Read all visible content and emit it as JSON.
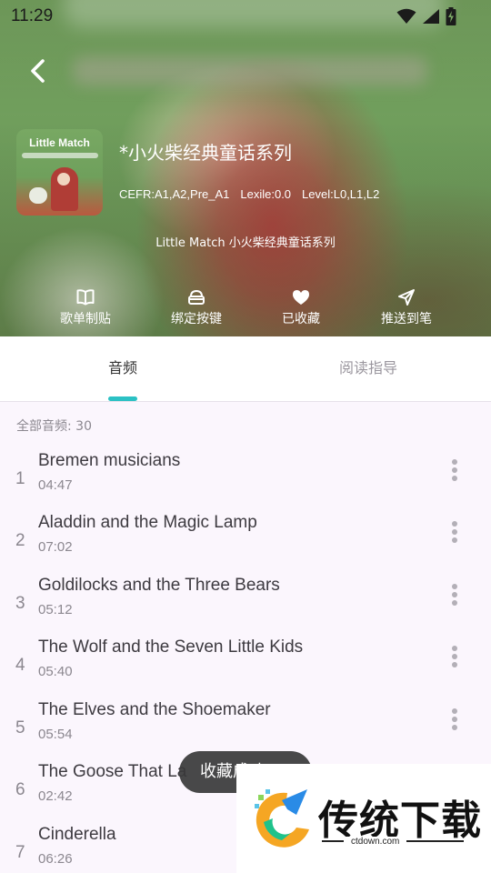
{
  "status_bar": {
    "time": "11:29",
    "icons": [
      "wifi-icon",
      "signal-icon",
      "battery-charging-icon"
    ]
  },
  "album": {
    "cover_title": "Little Match",
    "title": "*小火柴经典童话系列",
    "cefr": "CEFR:A1,A2,Pre_A1",
    "lexile": "Lexile:0.0",
    "level": "Level:L0,L1,L2",
    "description": "Little Match 小火柴经典童话系列"
  },
  "actions": [
    {
      "label": "歌单制贴",
      "icon": "book-icon"
    },
    {
      "label": "绑定按键",
      "icon": "button-icon"
    },
    {
      "label": "已收藏",
      "icon": "heart-icon"
    },
    {
      "label": "推送到笔",
      "icon": "send-icon"
    }
  ],
  "tabs": [
    {
      "label": "音频",
      "active": true
    },
    {
      "label": "阅读指导",
      "active": false
    }
  ],
  "list": {
    "count_label": "全部音频: 30",
    "tracks": [
      {
        "index": "1",
        "title": "Bremen musicians",
        "duration": "04:47"
      },
      {
        "index": "2",
        "title": "Aladdin and the Magic Lamp",
        "duration": "07:02"
      },
      {
        "index": "3",
        "title": "Goldilocks and the Three Bears",
        "duration": "05:12"
      },
      {
        "index": "4",
        "title": "The Wolf and the Seven Little Kids",
        "duration": "05:40"
      },
      {
        "index": "5",
        "title": "The Elves and the Shoemaker",
        "duration": "05:54"
      },
      {
        "index": "6",
        "title": "The Goose That La",
        "duration": "02:42"
      },
      {
        "index": "7",
        "title": "Cinderella",
        "duration": "06:26"
      }
    ]
  },
  "toast": {
    "text": "收藏成功"
  },
  "watermark": {
    "name": "传统下载",
    "url": "ctdown.com"
  },
  "colors": {
    "accent": "#2bc1c4",
    "list_bg": "#fbf6fd"
  }
}
